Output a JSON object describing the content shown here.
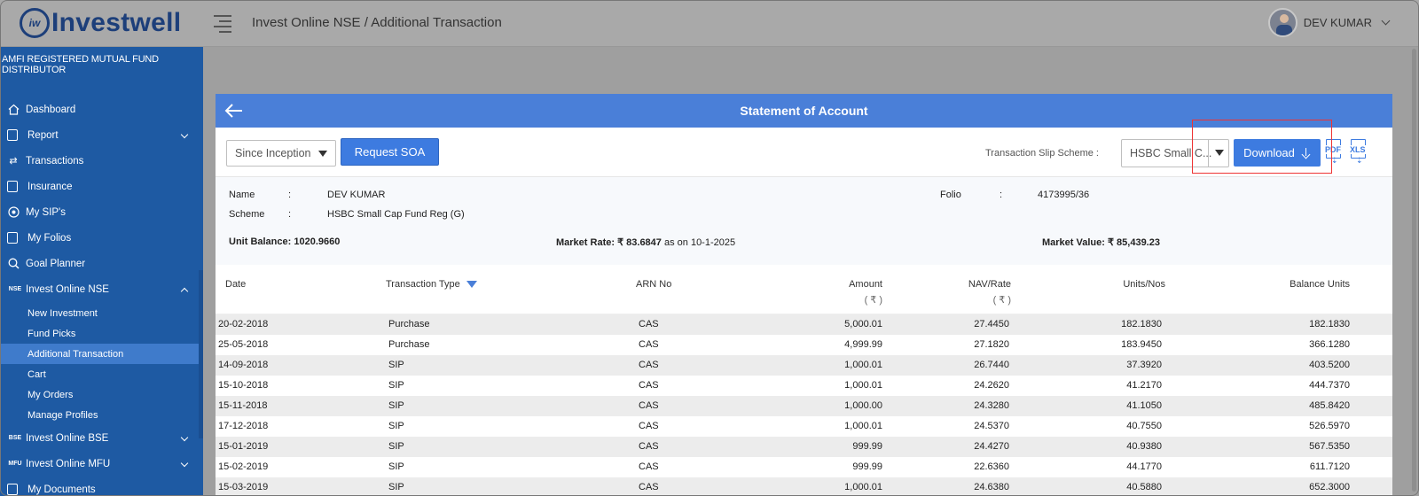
{
  "app": {
    "logo_text": "Investwell",
    "logo_mark": "iw"
  },
  "header": {
    "title": "Invest Online NSE / Additional Transaction",
    "user_name": "DEV KUMAR"
  },
  "sidebar": {
    "tagline": "AMFI REGISTERED MUTUAL FUND DISTRIBUTOR",
    "items": [
      {
        "label": "Dashboard",
        "icon": "home-icon"
      },
      {
        "label": "Report",
        "icon": "report-icon"
      },
      {
        "label": "Transactions",
        "icon": "transfer-icon"
      },
      {
        "label": "Insurance",
        "icon": "insurance-icon"
      },
      {
        "label": "My SIP's",
        "icon": "sip-icon"
      },
      {
        "label": "My Folios",
        "icon": "folios-icon"
      },
      {
        "label": "Goal Planner",
        "icon": "goal-icon"
      },
      {
        "label": "Invest Online NSE",
        "icon": "NSE"
      }
    ],
    "sub_items": [
      {
        "label": "New Investment"
      },
      {
        "label": "Fund Picks"
      },
      {
        "label": "Additional Transaction"
      },
      {
        "label": "Cart"
      },
      {
        "label": "My Orders"
      },
      {
        "label": "Manage Profiles"
      }
    ],
    "more_items": [
      {
        "label": "Invest Online BSE",
        "icon": "BSE"
      },
      {
        "label": "Invest Online MFU",
        "icon": "MFU"
      },
      {
        "label": "My Documents",
        "icon": "documents-icon"
      }
    ]
  },
  "card": {
    "title": "Statement of Account",
    "period": "Since Inception",
    "request_label": "Request SOA",
    "slip_label": "Transaction Slip Scheme :",
    "scheme_selected": "HSBC Small C...",
    "download_label": "Download",
    "pdf_label": "PDF",
    "xls_label": "XLS"
  },
  "info": {
    "name_label": "Name",
    "name_value": "DEV KUMAR",
    "scheme_label": "Scheme",
    "scheme_value": "HSBC Small Cap Fund Reg (G)",
    "folio_label": "Folio",
    "folio_value": "4173995/36",
    "colon": ":",
    "unit_balance_label": "Unit Balance:",
    "unit_balance_value": "1020.9660",
    "market_rate_label": "Market Rate:",
    "market_rate_value": "₹ 83.6847",
    "market_rate_date": "as on 10-1-2025",
    "market_value_label": "Market Value:",
    "market_value_value": "₹ 85,439.23"
  },
  "table": {
    "headers": {
      "date": "Date",
      "type": "Transaction Type",
      "arn": "ARN No",
      "amount": "Amount",
      "amount_unit": "( ₹ )",
      "nav": "NAV/Rate",
      "nav_unit": "( ₹ )",
      "units": "Units/Nos",
      "balance": "Balance Units"
    },
    "rows": [
      [
        "20-02-2018",
        "Purchase",
        "CAS",
        "5,000.01",
        "27.4450",
        "182.1830",
        "182.1830"
      ],
      [
        "25-05-2018",
        "Purchase",
        "CAS",
        "4,999.99",
        "27.1820",
        "183.9450",
        "366.1280"
      ],
      [
        "14-09-2018",
        "SIP",
        "CAS",
        "1,000.01",
        "26.7440",
        "37.3920",
        "403.5200"
      ],
      [
        "15-10-2018",
        "SIP",
        "CAS",
        "1,000.01",
        "24.2620",
        "41.2170",
        "444.7370"
      ],
      [
        "15-11-2018",
        "SIP",
        "CAS",
        "1,000.00",
        "24.3280",
        "41.1050",
        "485.8420"
      ],
      [
        "17-12-2018",
        "SIP",
        "CAS",
        "1,000.01",
        "24.5370",
        "40.7550",
        "526.5970"
      ],
      [
        "15-01-2019",
        "SIP",
        "CAS",
        "999.99",
        "24.4270",
        "40.9380",
        "567.5350"
      ],
      [
        "15-02-2019",
        "SIP",
        "CAS",
        "999.99",
        "22.6360",
        "44.1770",
        "611.7120"
      ],
      [
        "15-03-2019",
        "SIP",
        "CAS",
        "1,000.01",
        "24.6380",
        "40.5880",
        "652.3000"
      ]
    ]
  }
}
